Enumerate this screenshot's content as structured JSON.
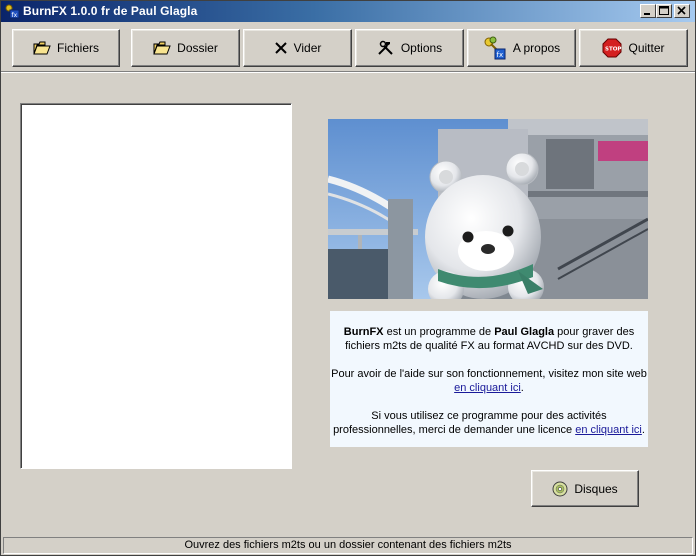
{
  "window": {
    "title": "BurnFX 1.0.0 fr de Paul Glagla"
  },
  "toolbar": {
    "buttons": [
      {
        "label": "Fichiers",
        "icon": "open-folder-icon"
      },
      {
        "label": "Dossier",
        "icon": "open-folder-icon"
      },
      {
        "label": "Vider",
        "icon": "x-icon"
      },
      {
        "label": "Options",
        "icon": "tools-icon"
      },
      {
        "label": "A propos",
        "icon": "info-keys-icon"
      },
      {
        "label": "Quitter",
        "icon": "stop-sign-icon"
      }
    ]
  },
  "info": {
    "app_name": "BurnFX",
    "line1_mid": " est un programme de ",
    "author": "Paul Glagla",
    "line1_end": " pour graver des fichiers m2ts de qualité FX au format AVCHD sur des DVD.",
    "help_text": "Pour avoir de l'aide sur son fonctionnement, visitez mon site web ",
    "help_link": "en cliquant ici",
    "help_end": ".",
    "license_text": "Si vous utilisez ce programme pour des activités professionnelles, merci de demander une licence ",
    "license_link": "en cliquant ici",
    "license_end": "."
  },
  "disques_button": {
    "label": "Disques",
    "icon": "disc-icon"
  },
  "status": {
    "text": "Ouvrez des fichiers m2ts ou un dossier contenant des fichiers m2ts"
  }
}
